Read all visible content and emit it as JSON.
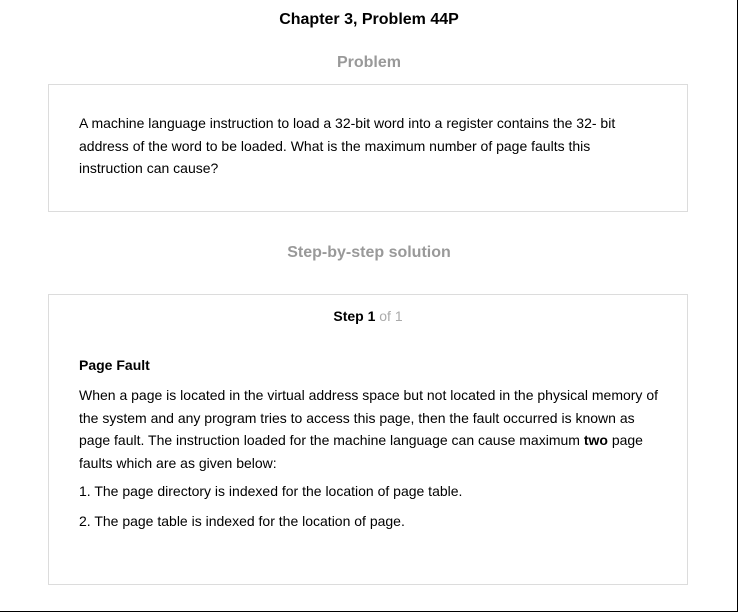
{
  "chapter_title": "Chapter 3, Problem 44P",
  "problem": {
    "heading": "Problem",
    "text": "A machine language instruction to load a 32-bit word into a register contains the 32- bit address of the word to be loaded. What is the maximum number of page faults this instruction can cause?"
  },
  "solution": {
    "heading": "Step-by-step solution",
    "step": {
      "label": "Step 1",
      "of": "of 1"
    },
    "subheading": "Page Fault",
    "paragraph_before": "When a page is located in the virtual address space but not located in the physical memory of the system and any program tries to access this page, then the fault occurred is known as page fault. The instruction loaded for the machine language can cause maximum ",
    "paragraph_bold": "two",
    "paragraph_after": " page faults which are as given below:",
    "list": [
      "1. The page directory is indexed for the location of page table.",
      "2. The page table is indexed for the location of page."
    ]
  },
  "colors": {
    "heading_gray": "#999999",
    "step_of_gray": "#aaaaaa",
    "box_border": "#dcdcdc"
  }
}
